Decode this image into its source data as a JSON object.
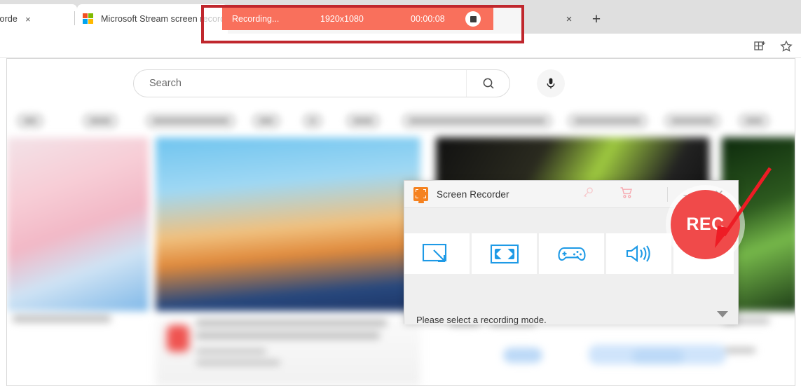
{
  "browser": {
    "tabs": [
      {
        "title": "reen Recorde",
        "favicon": "none",
        "close_label": "×"
      },
      {
        "title": "Microsoft Stream screen record",
        "favicon": "microsoft-logo",
        "close_label": ""
      }
    ],
    "tab_close_label": "×",
    "new_tab_label": "+",
    "toolbar": {
      "collections_icon": "collections-icon",
      "favorites_icon": "favorites-star-icon"
    }
  },
  "page": {
    "search": {
      "placeholder": "Search",
      "value": "",
      "search_icon": "magnifier-icon",
      "mic_icon": "microphone-icon"
    },
    "chips": [
      "",
      "",
      "",
      "",
      "",
      "",
      "",
      "",
      "",
      "",
      ""
    ]
  },
  "recording_bar": {
    "status": "Recording...",
    "resolution": "1920x1080",
    "elapsed": "00:00:08",
    "stop_icon": "stop-square-icon",
    "background_color": "#f9705c"
  },
  "recorder": {
    "title": "Screen Recorder",
    "app_icon": "screen-recorder-icon",
    "titlebar_icons": [
      {
        "name": "key-icon",
        "label": ""
      },
      {
        "name": "cart-icon",
        "label": ""
      }
    ],
    "minimize_label": "—",
    "close_label": "✕",
    "modes": [
      {
        "name": "region-capture",
        "icon": "region-capture-icon"
      },
      {
        "name": "full-screen",
        "icon": "fullscreen-icon"
      },
      {
        "name": "game-recording",
        "icon": "gamepad-icon"
      },
      {
        "name": "audio-recording",
        "icon": "speaker-icon"
      }
    ],
    "rec_label": "REC",
    "hint": "Please select a recording mode.",
    "expand_icon": "caret-down-icon",
    "accent_color": "#f04a4a",
    "icon_color": "#1e9ae6"
  },
  "annotations": {
    "highlight_box_color": "#c0272d",
    "arrow_color": "#ee1c25"
  }
}
